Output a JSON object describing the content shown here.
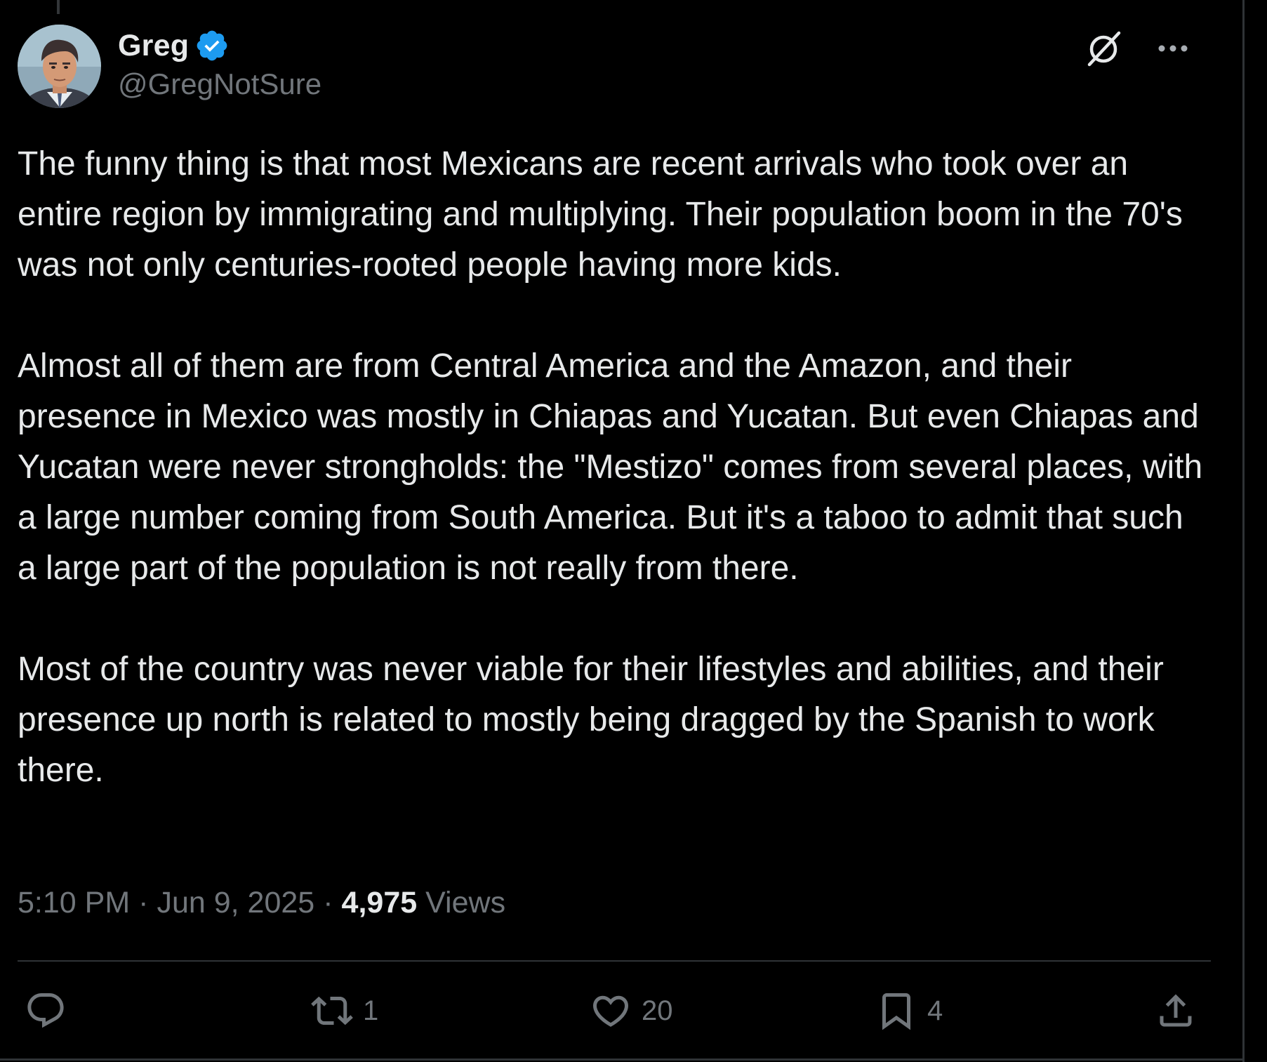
{
  "author": {
    "display_name": "Greg",
    "handle": "@GregNotSure",
    "verified": true
  },
  "post": {
    "paragraphs": [
      "The funny thing is that most Mexicans are recent arrivals who took over an entire region by immigrating and multiplying. Their population boom in the 70's was not only centuries-rooted people having more kids.",
      "Almost all of them are from Central America and the Amazon, and their presence in Mexico was mostly in Chiapas and Yucatan. But even Chiapas and Yucatan were never strongholds: the \"Mestizo\" comes from several places, with a large number coming from South America. But it's a taboo to admit that such a large part of the population is not really from there.",
      "Most of the country was never viable for their lifestyles and abilities, and their presence up north is related to mostly being dragged by the Spanish to work there."
    ],
    "time": "5:10 PM",
    "date": "Jun 9, 2025",
    "separator": "·",
    "views_count": "4,975",
    "views_label": "Views"
  },
  "engagement": {
    "replies": "",
    "reposts": "1",
    "likes": "20",
    "bookmarks": "4"
  },
  "icons": {
    "top": [
      "grok-icon",
      "more-icon"
    ],
    "actions": [
      "reply-icon",
      "repost-icon",
      "like-icon",
      "bookmark-icon",
      "share-icon"
    ]
  },
  "colors": {
    "background": "#000000",
    "text": "#e7e9ea",
    "secondary": "#71767b",
    "verified": "#1d9bf0",
    "border": "#2f3336"
  }
}
